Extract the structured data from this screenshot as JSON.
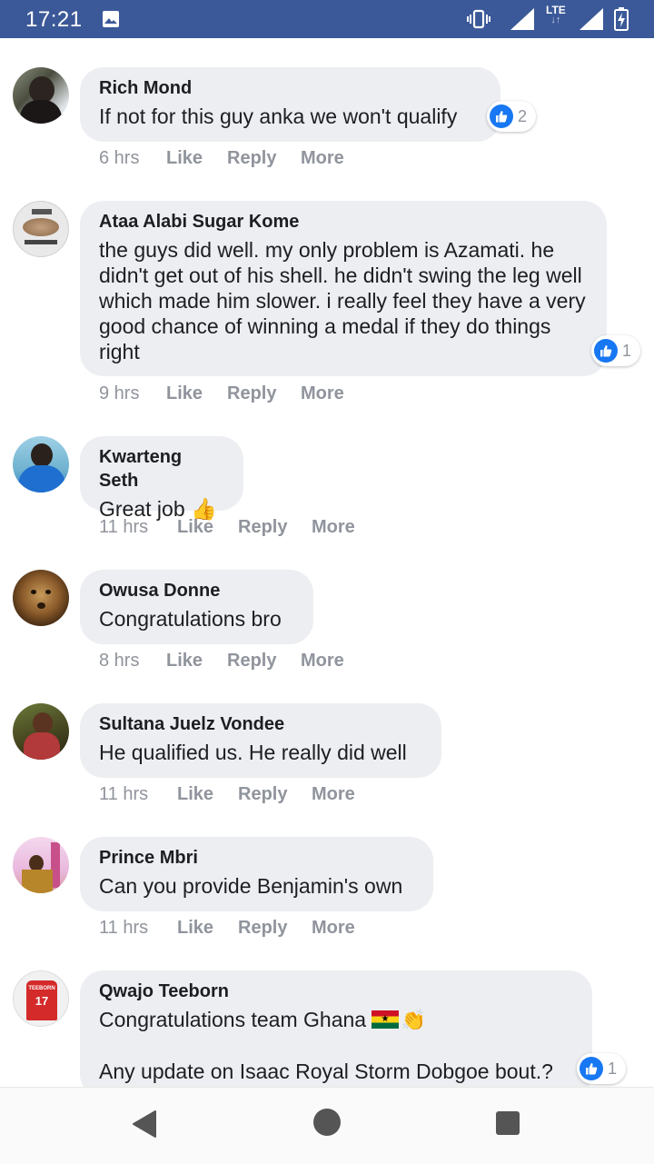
{
  "status_bar": {
    "time": "17:21",
    "network": "LTE"
  },
  "actions": {
    "like": "Like",
    "reply": "Reply",
    "more": "More"
  },
  "comments": [
    {
      "author": "Rich Mond",
      "text": "If not for this guy anka we won't qualify",
      "time": "6 hrs",
      "likes": "2"
    },
    {
      "author": "Ataa Alabi Sugar Kome",
      "text": "the guys did well. my only problem is Azamati. he didn't get out of his shell. he didn't swing the leg well which made him slower. i really feel they have a very good chance of winning a medal if they do things right",
      "time": "9 hrs",
      "likes": "1"
    },
    {
      "author": "Kwarteng Seth",
      "text": "Great job 👍",
      "time": "11 hrs"
    },
    {
      "author": "Owusa Donne",
      "text": "Congratulations bro",
      "time": "8 hrs"
    },
    {
      "author": "Sultana Juelz Vondee",
      "text": "He qualified us. He really did well",
      "time": "11 hrs"
    },
    {
      "author": "Prince Mbri",
      "text": "Can you provide Benjamin's own",
      "time": "11 hrs"
    },
    {
      "author": "Qwajo Teeborn",
      "text": "Congratulations team Ghana",
      "text2": "Any update on Isaac Royal Storm Dobgoe bout.?",
      "likes": "1",
      "jersey_text": "TEEBORN",
      "jersey_number": "17"
    }
  ],
  "colors": {
    "accent": "#3b5998",
    "bubble": "#eceef1",
    "like_blue": "#1877f2",
    "meta": "#90949c"
  },
  "icons": [
    "image-icon",
    "vibrate-icon",
    "signal-icon",
    "battery-icon",
    "like-icon",
    "thumbs-up-emoji",
    "ghana-flag-emoji",
    "clapping-hands-emoji",
    "back-icon",
    "home-icon",
    "recent-apps-icon"
  ]
}
